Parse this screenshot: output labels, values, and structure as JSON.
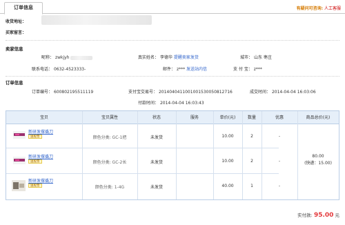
{
  "tab": {
    "label": "订单信息"
  },
  "help": {
    "question": "有疑问可咨询:",
    "service": "人工客服"
  },
  "buyer": {
    "address_label": "收货地址：",
    "message_label": "买家留言："
  },
  "seller": {
    "section_title": "卖家信息",
    "nickname_label": "昵称：",
    "nickname_value": "zwkjyh",
    "realname_label": "真实姓名：",
    "realname_value": "李德华",
    "remind_link": "提醒卖家发货",
    "city_label": "城市：",
    "city_value": "山东 枣庄",
    "phone_label": "联系电话：",
    "phone_value": "0632-4523333-",
    "email_label": "邮件：",
    "email_value": "z***",
    "email_link": "发送站内信",
    "alipay_label": "支 付 宝：",
    "alipay_value": "z***"
  },
  "order": {
    "section_title": "订单信息",
    "order_no_label": "订单编号：",
    "order_no_value": "600802195511119",
    "trade_no_label": "支付宝交易号：",
    "trade_no_value": "2014040411001001530050812716",
    "created_label": "成交时间：",
    "created_value": "2014-04-04 16:03:06",
    "paid_label": "付款时间：",
    "paid_value": "2014-04-04 16:03:43"
  },
  "table": {
    "headers": [
      "宝贝",
      "宝贝属性",
      "状态",
      "服务",
      "单价(元)",
      "数量",
      "优惠",
      "商品总价(元)"
    ],
    "rows": [
      {
        "name": "新研发撑撬刀",
        "badge": "送股票",
        "attr": "颜色分类: GC-1把",
        "status": "未发货",
        "service": "",
        "price": "10.00",
        "qty": "2",
        "discount": "-"
      },
      {
        "name": "新研发撑撬刀",
        "badge": "送股票",
        "attr": "颜色分类: GC-2长",
        "status": "未发货",
        "service": "",
        "price": "10.00",
        "qty": "2",
        "discount": "-"
      },
      {
        "name": "新研发撑撬刀",
        "badge": "送股票",
        "attr": "颜色分类: 1-4G",
        "status": "未发货",
        "service": "",
        "price": "40.00",
        "qty": "1",
        "discount": "-"
      }
    ],
    "subtotal": "80.00",
    "shipping": "(快递：15.00)"
  },
  "summary": {
    "paid_label": "实付款:",
    "paid_value": "95.00",
    "unit": "元"
  },
  "colors": {
    "accent_orange": "#d57a00",
    "price_red": "#e4393c",
    "link_blue": "#3366cc",
    "table_header_bg": "#e6eff9"
  }
}
